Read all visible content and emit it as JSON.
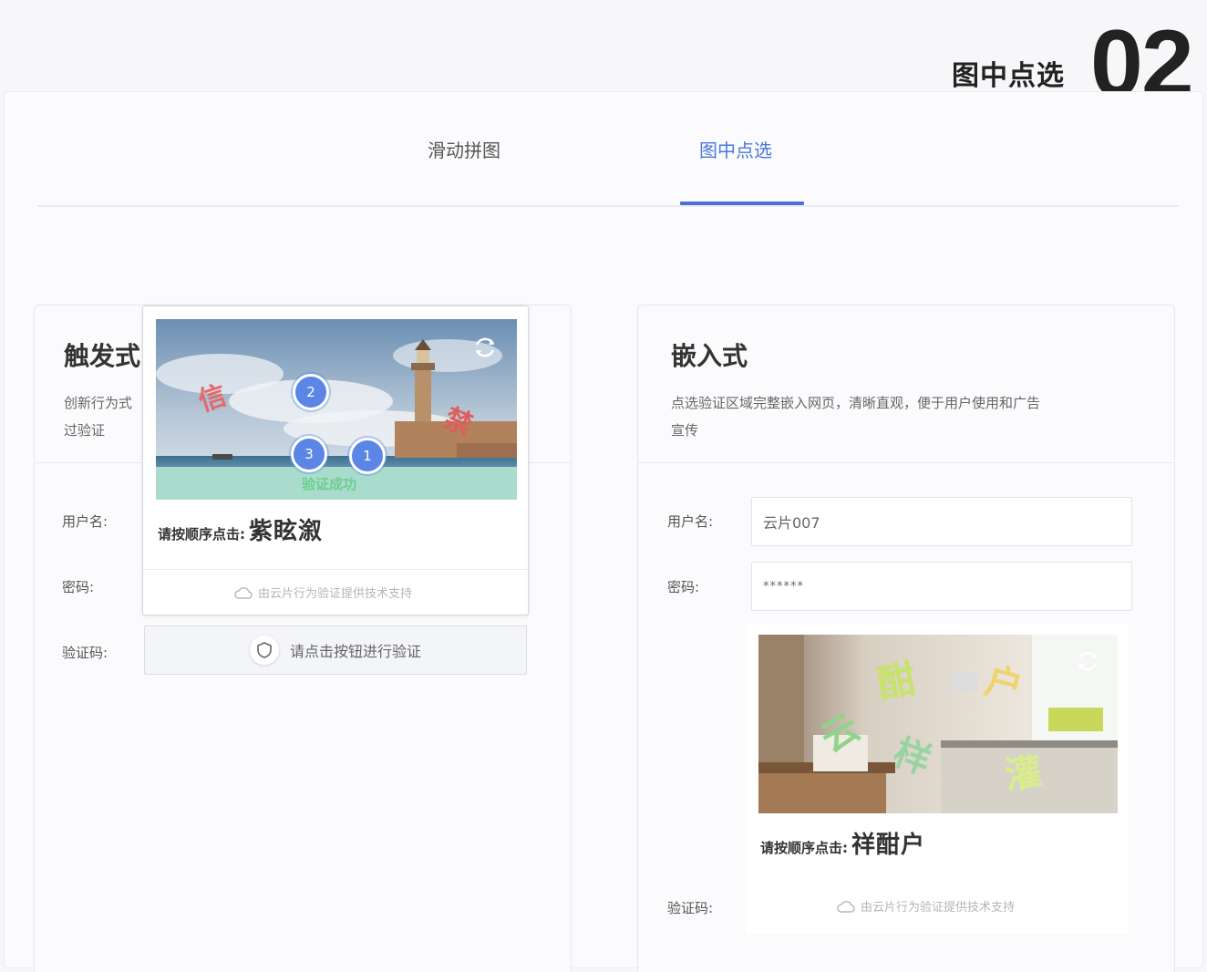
{
  "badge": {
    "title": "图中点选",
    "number": "02"
  },
  "tabs": [
    {
      "label": "滑动拼图",
      "active": false
    },
    {
      "label": "图中点选",
      "active": true
    }
  ],
  "colors": {
    "accent": "#4a6fdc",
    "marker": "#5b86e5",
    "success": "#6ccf8e"
  },
  "left_card": {
    "title": "触发式",
    "desc_line1": "创新行为式",
    "desc_line2": "过验证",
    "username_label": "用户名:",
    "password_label": "密码:",
    "captcha_label": "验证码:",
    "verify_button": "请点击按钮进行验证",
    "popup": {
      "hint_label": "请按顺序点击:",
      "hint_chars": "紫眩溆",
      "success": "验证成功",
      "markers": [
        "2",
        "3",
        "1"
      ],
      "scene_chars": [
        "信",
        "禁"
      ],
      "footer": "由云片行为验证提供技术支持",
      "refresh_icon": "refresh-icon"
    }
  },
  "right_card": {
    "title": "嵌入式",
    "desc_line1": "点选验证区域完整嵌入网页，清晰直观，便于用户使用和广告",
    "desc_line2": "宣传",
    "username_label": "用户名:",
    "username_value": "云片007",
    "password_label": "密码:",
    "password_value": "******",
    "captcha_label": "验证码:",
    "embed": {
      "hint_label": "请按顺序点击:",
      "hint_chars": "祥酣户",
      "scene_chars": [
        "酣",
        "户",
        "云",
        "样",
        "灌"
      ],
      "footer": "由云片行为验证提供技术支持",
      "refresh_icon": "refresh-icon"
    }
  }
}
